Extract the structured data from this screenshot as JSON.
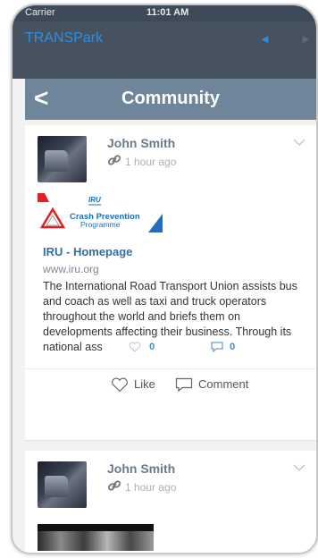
{
  "status_bar": {
    "carrier": "Carrier",
    "time": "11:01 AM"
  },
  "app": {
    "title": "TRANSPark"
  },
  "titlebar": {
    "back_label": "<",
    "title": "Community"
  },
  "posts": [
    {
      "author": "John Smith",
      "time": "1 hour ago",
      "logo": {
        "brand": "IRU",
        "line1": "Crash Prevention",
        "line2": "Programme",
        "colors": {
          "red": "#e31e24",
          "blue": "#1c6fc1"
        }
      },
      "link_title": "IRU - Homepage",
      "link_url": "www.iru.org",
      "description": "The International Road Transport Union assists bus and coach as well as taxi and truck operators throughout the world and briefs them on developments affecting their business. Through its national ass",
      "likes": "0",
      "comments": "0",
      "like_label": "Like",
      "comment_label": "Comment"
    },
    {
      "author": "John Smith",
      "time": "1 hour ago"
    }
  ],
  "colors": {
    "accent": "#2d8ee6",
    "titlebar": "#6f8599",
    "appbar": "#46525f",
    "link": "#2f6fa6"
  },
  "icons": [
    "link-icon",
    "chevron-down-icon",
    "heart-icon",
    "comment-icon",
    "back-chevron-icon",
    "nav-arrow-icon"
  ]
}
